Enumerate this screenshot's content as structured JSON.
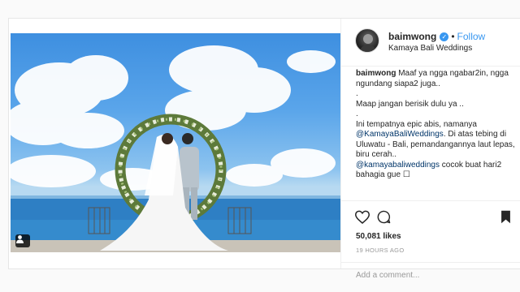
{
  "post": {
    "username": "baimwong",
    "follow_label": "Follow",
    "separator": "•",
    "verified_mark": "✓",
    "location": "Kamaya Bali Weddings",
    "caption": {
      "line1_user": "baimwong",
      "line1_text": " Maaf ya ngga ngabar2in, ngga ngundang siapa2 juga..",
      "dot1": ".",
      "line2": "Maap jangan berisik dulu ya ..",
      "dot2": ".",
      "line3_text": "Ini tempatnya epic abis, namanya ",
      "line3_mention": "@KamayaBaliWeddings",
      "line3_rest": ". Di atas tebing di Uluwatu - Bali, pemandangannya laut lepas, biru cerah..",
      "line4_mention": "@kamayabaliweddings",
      "line4_text": " cocok buat hari2 bahagia gue ☐"
    },
    "likes": "50,081 likes",
    "time": "19 HOURS AGO",
    "comment_placeholder": "Add a comment..."
  },
  "icons": {
    "like": "heart-icon",
    "comment": "comment-bubble-icon",
    "save": "bookmark-icon",
    "tag": "user-tag-icon"
  },
  "colors": {
    "accent": "#3897f0",
    "text": "#262626",
    "muted": "#999999",
    "border": "#efefef",
    "mention": "#003569"
  }
}
